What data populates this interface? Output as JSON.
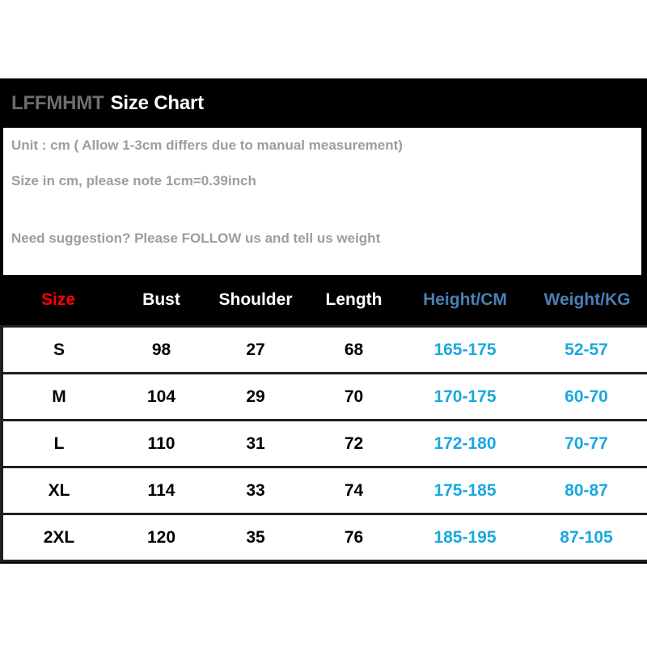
{
  "header": {
    "brand": "LFFMHMT",
    "title": "Size Chart"
  },
  "notes": {
    "line1": "Unit : cm ( Allow 1-3cm differs due to manual measurement)",
    "line2": "Size in cm, please note 1cm=0.39inch",
    "line3": "Need suggestion? Please FOLLOW us and tell us weight"
  },
  "colors": {
    "panel_background": "#000000",
    "note_text": "#9d9d9d",
    "brand_text": "#6e6e6e",
    "title_text": "#ffffff",
    "size_header": "#ff0000",
    "header_plain": "#ffffff",
    "header_blue": "#4b7fb6",
    "value_blue": "#18a8e0",
    "value_text": "#000000",
    "row_border": "#231f20"
  },
  "table": {
    "columns": [
      {
        "label": "Size",
        "style": "size"
      },
      {
        "label": "Bust",
        "style": "plain"
      },
      {
        "label": "Shoulder",
        "style": "plain"
      },
      {
        "label": "Length",
        "style": "plain"
      },
      {
        "label": "Height/CM",
        "style": "blue"
      },
      {
        "label": "Weight/KG",
        "style": "blue"
      }
    ],
    "rows": [
      {
        "size": "S",
        "bust": "98",
        "shoulder": "27",
        "length": "68",
        "height": "165-175",
        "weight": "52-57"
      },
      {
        "size": "M",
        "bust": "104",
        "shoulder": "29",
        "length": "70",
        "height": "170-175",
        "weight": "60-70"
      },
      {
        "size": "L",
        "bust": "110",
        "shoulder": "31",
        "length": "72",
        "height": "172-180",
        "weight": "70-77"
      },
      {
        "size": "XL",
        "bust": "114",
        "shoulder": "33",
        "length": "74",
        "height": "175-185",
        "weight": "80-87"
      },
      {
        "size": "2XL",
        "bust": "120",
        "shoulder": "35",
        "length": "76",
        "height": "185-195",
        "weight": "87-105"
      }
    ]
  }
}
